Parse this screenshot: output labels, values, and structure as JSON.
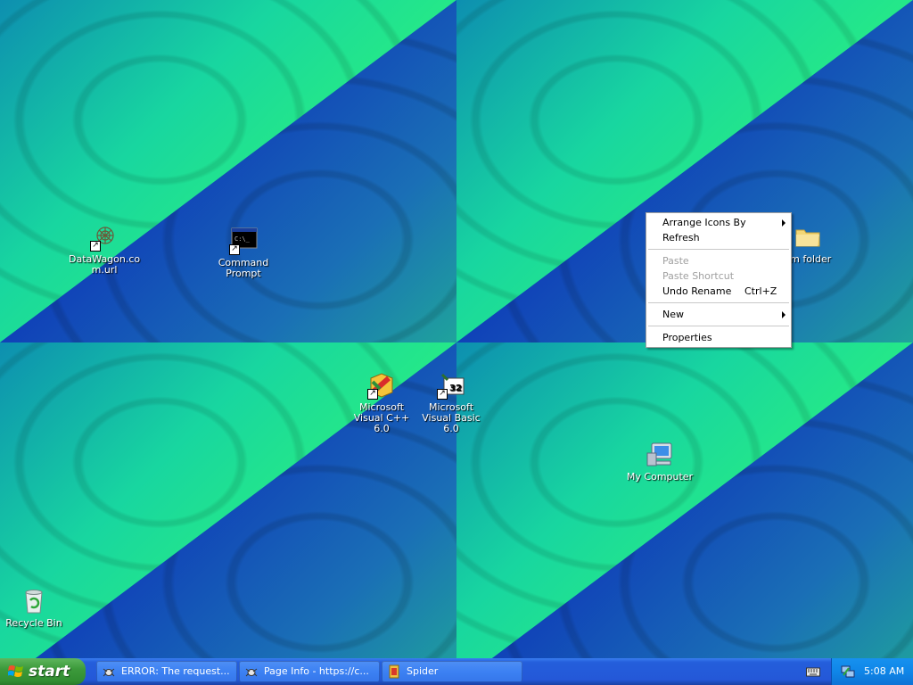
{
  "desktop": {
    "icons": [
      {
        "id": "datawagon",
        "label": "DataWagon.co m.url"
      },
      {
        "id": "cmd",
        "label": "Command Prompt"
      },
      {
        "id": "folder",
        "label": "vm folder"
      },
      {
        "id": "vcpp",
        "label": "Microsoft Visual C++ 6.0"
      },
      {
        "id": "vb",
        "label": "Microsoft Visual Basic 6.0"
      },
      {
        "id": "mycomputer",
        "label": "My Computer"
      },
      {
        "id": "recycle",
        "label": "Recycle Bin"
      }
    ]
  },
  "context_menu": {
    "items": [
      {
        "label": "Arrange Icons By",
        "submenu": true,
        "disabled": false
      },
      {
        "label": "Refresh",
        "disabled": false
      },
      {
        "label": "Paste",
        "disabled": true
      },
      {
        "label": "Paste Shortcut",
        "disabled": true
      },
      {
        "label": "Undo Rename",
        "shortcut": "Ctrl+Z",
        "disabled": false
      },
      {
        "label": "New",
        "submenu": true,
        "disabled": false
      },
      {
        "label": "Properties",
        "disabled": false
      }
    ]
  },
  "taskbar": {
    "start_label": "start",
    "tasks": [
      {
        "label": "ERROR: The request...",
        "icon": "spider-browser-icon"
      },
      {
        "label": "Page Info - https://c...",
        "icon": "spider-browser-icon"
      },
      {
        "label": "Spider",
        "icon": "spider-app-icon"
      }
    ],
    "clock": "5:08 AM"
  },
  "colors": {
    "desktop_green": "#2cf37a",
    "desktop_blue": "#0a1fa8",
    "taskbar_blue": "#245edb",
    "start_green": "#3c9a3b",
    "tray_blue": "#0f86e8"
  }
}
